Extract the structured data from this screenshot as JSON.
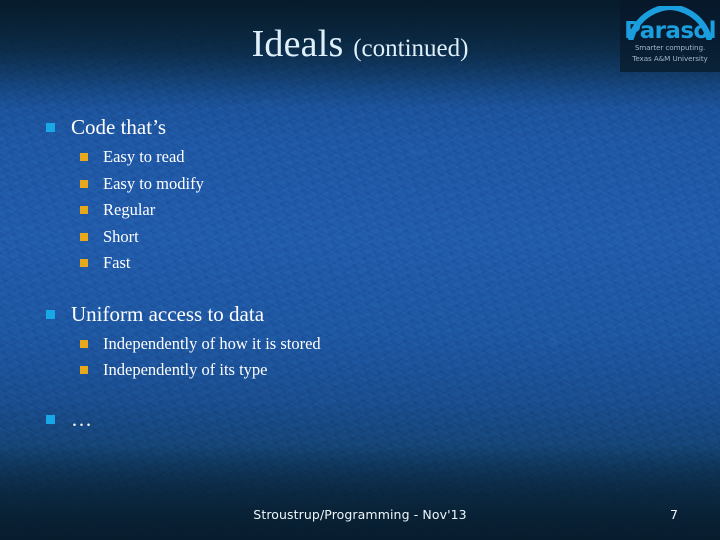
{
  "slide": {
    "title_main": "Ideals ",
    "title_sub": "(continued)",
    "page_number": "7",
    "footer": "Stroustrup/Programming - Nov'13"
  },
  "logo": {
    "wordmark": "Parasol",
    "tagline_line1": "Smarter computing.",
    "tagline_line2": "Texas A&M University",
    "arc_color": "#1a9ede",
    "wordmark_color": "#1a9ede"
  },
  "colors": {
    "level1_bullet": "#18a8e8",
    "level2_bullet": "#e8a81c",
    "text": "#ffffff",
    "title": "#dff0fb",
    "background": "#1e56a0"
  },
  "content": {
    "groups": [
      {
        "heading": "Code that’s",
        "items": [
          "Easy to read",
          "Easy to modify",
          "Regular",
          "Short",
          "Fast"
        ]
      },
      {
        "heading": "Uniform access to data",
        "items": [
          "Independently of how it is stored",
          "Independently of its type"
        ]
      },
      {
        "heading": "…",
        "items": []
      }
    ]
  }
}
